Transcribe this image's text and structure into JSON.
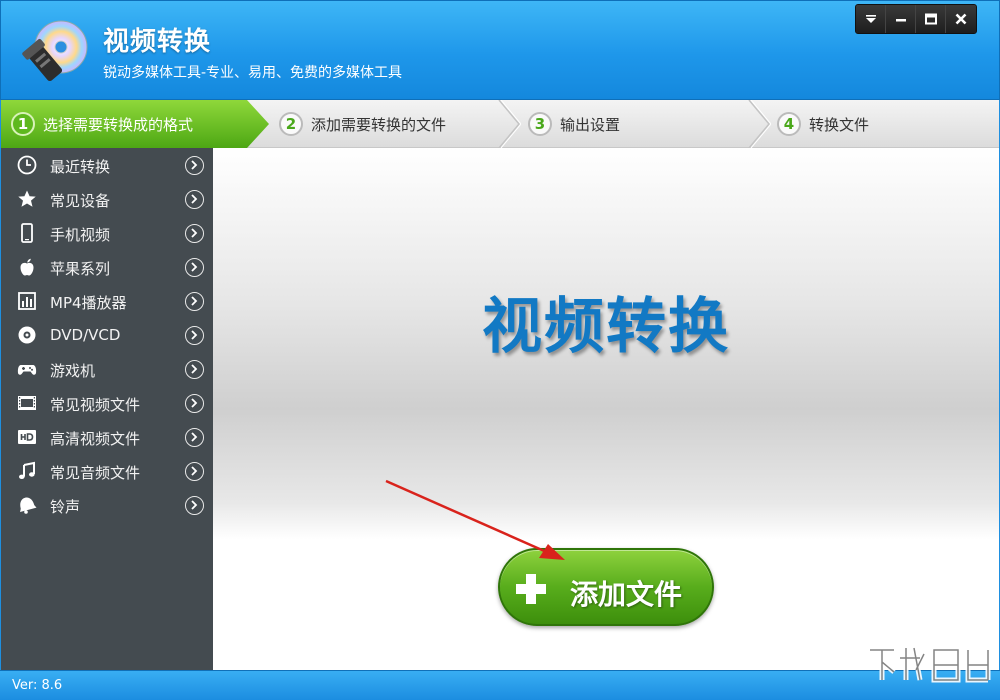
{
  "app": {
    "title": "视频转换",
    "subtitle": "锐动多媒体工具-专业、易用、免费的多媒体工具"
  },
  "window_controls": [
    {
      "name": "menu-dropdown-button",
      "icon": "dropdown-icon"
    },
    {
      "name": "minimize-button",
      "icon": "minimize-icon"
    },
    {
      "name": "maximize-button",
      "icon": "maximize-icon"
    },
    {
      "name": "close-button",
      "icon": "close-icon"
    }
  ],
  "steps": [
    {
      "num": "1",
      "label": "选择需要转换成的格式",
      "active": true
    },
    {
      "num": "2",
      "label": "添加需要转换的文件",
      "active": false
    },
    {
      "num": "3",
      "label": "输出设置",
      "active": false
    },
    {
      "num": "4",
      "label": "转换文件",
      "active": false
    }
  ],
  "sidebar": {
    "items": [
      {
        "label": "最近转换",
        "icon": "clock-icon"
      },
      {
        "label": "常见设备",
        "icon": "star-icon"
      },
      {
        "label": "手机视频",
        "icon": "phone-icon"
      },
      {
        "label": "苹果系列",
        "icon": "apple-icon"
      },
      {
        "label": "MP4播放器",
        "icon": "mp4-player-icon"
      },
      {
        "label": "DVD/VCD",
        "icon": "disc-icon"
      },
      {
        "label": "游戏机",
        "icon": "gamepad-icon"
      },
      {
        "label": "常见视频文件",
        "icon": "film-icon"
      },
      {
        "label": "高清视频文件",
        "icon": "hd-icon"
      },
      {
        "label": "常见音频文件",
        "icon": "music-note-icon"
      },
      {
        "label": "铃声",
        "icon": "bell-icon"
      }
    ]
  },
  "main": {
    "hero_title": "视频转换",
    "add_button_label": "添加文件"
  },
  "footer": {
    "version": "Ver: 8.6"
  },
  "colors": {
    "title_bar": "#1e97ea",
    "active_step": "#5eb81e",
    "sidebar": "#444b50",
    "hero_text": "#1279c4",
    "add_button": "#58ad1c",
    "pointer_arrow": "#d9231c"
  }
}
